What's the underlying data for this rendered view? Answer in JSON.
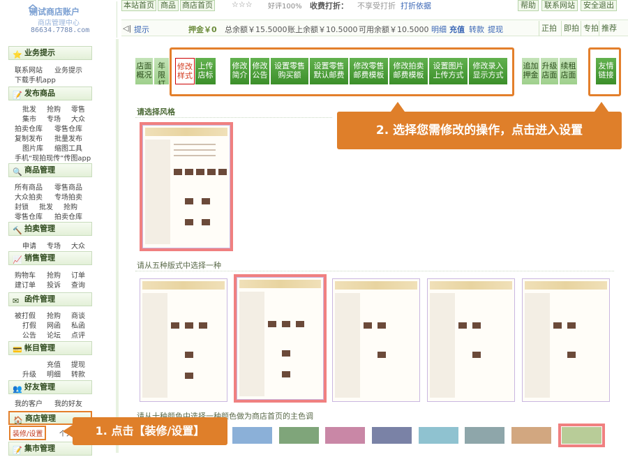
{
  "header": {
    "logo_title": "测试商店账户",
    "logo_sub": "商店管理中心",
    "logo_url": "86634.7788.com",
    "nav": [
      "本站首页",
      "商品",
      "商店首页"
    ],
    "stars": "☆☆☆",
    "good_rate": "好评100%",
    "discount_label": "收费打折：",
    "discount_value": "不享受打折",
    "discount_link": "打折依据",
    "right_nav": [
      "帮助",
      "联系网站",
      "安全退出"
    ]
  },
  "bar2": {
    "hint": "提示",
    "deposit": "押金￥0",
    "total": "总余额￥15.5000",
    "account": "账上余额￥10.5000",
    "available": "可用余额￥10.5000",
    "detail": "明细",
    "recharge": "充值",
    "transfer": "转款",
    "withdraw": "提现",
    "buttons": [
      "正拍",
      "即拍",
      "专拍",
      "推荐"
    ]
  },
  "sidebar": {
    "sections": [
      {
        "title": "业务提示",
        "icon": "star-icon",
        "links": [
          "联系网站",
          "业务提示",
          "下载手机app"
        ]
      },
      {
        "title": "发布商品",
        "icon": "edit-icon",
        "links": [
          "批发",
          "抢购",
          "零售",
          "集市",
          "专场",
          "大众",
          "拍卖仓库",
          "零售仓库",
          "复制发布",
          "批量发布",
          "图片库",
          "缩图工具",
          "手机“现拍现传”传图app"
        ]
      },
      {
        "title": "商品管理",
        "icon": "magnifier-icon",
        "links": [
          "所有商品",
          "零售商品",
          "大众拍卖",
          "专场拍卖",
          "封锁",
          "批发",
          "抢购",
          "零售仓库",
          "拍卖仓库"
        ]
      },
      {
        "title": "拍卖管理",
        "icon": "gavel-icon",
        "links": [
          "申请",
          "专场",
          "大众"
        ]
      },
      {
        "title": "销售管理",
        "icon": "chart-icon",
        "links": [
          "购物车",
          "抢购",
          "订单",
          "建订单",
          "投诉",
          "查询"
        ]
      },
      {
        "title": "函件管理",
        "icon": "mail-icon",
        "links": [
          "被打假",
          "抢购",
          "商谈",
          "打假",
          "网函",
          "私函",
          "公告",
          "论坛",
          "点评"
        ]
      },
      {
        "title": "帐目管理",
        "icon": "card-icon",
        "links": [
          "充值",
          "提现",
          "升级",
          "明细",
          "转款"
        ]
      },
      {
        "title": "好友管理",
        "icon": "people-icon",
        "links": [
          "我的客户",
          "我的好友"
        ]
      },
      {
        "title": "商店管理",
        "icon": "home-icon",
        "links": [
          "装修/设置",
          "个人"
        ]
      },
      {
        "title": "集市管理",
        "icon": "edit-icon",
        "links": []
      }
    ]
  },
  "tabs": [
    "店面\n概况",
    "年限\n打折",
    "修改\n样式",
    "上传\n店标",
    "修改\n简介",
    "修改\n公告",
    "设置零售\n购买额",
    "设置零售\n默认邮费",
    "修改零售\n邮费模板",
    "修改拍卖\n邮费模板",
    "设置图片\n上传方式",
    "修改录入\n显示方式",
    "追加\n押金",
    "升级\n店面",
    "续租\n店面",
    "友情\n链接"
  ],
  "callouts": {
    "step2": "2. 选择您需修改的操作，点击进入设置",
    "step1": "1. 点击【装修/设置】"
  },
  "content": {
    "style_label": "请选择风格",
    "layout_label": "请从五种版式中选择一种",
    "color_label": "请从十种颜色中选择一种颜色做为商店首页的主色调"
  },
  "swatch_colors": [
    "#8bb0d8",
    "#7fa57a",
    "#c987a6",
    "#7a82a6",
    "#8fc2d0",
    "#8ea6aa",
    "#d2a780",
    "#b8cc98"
  ]
}
